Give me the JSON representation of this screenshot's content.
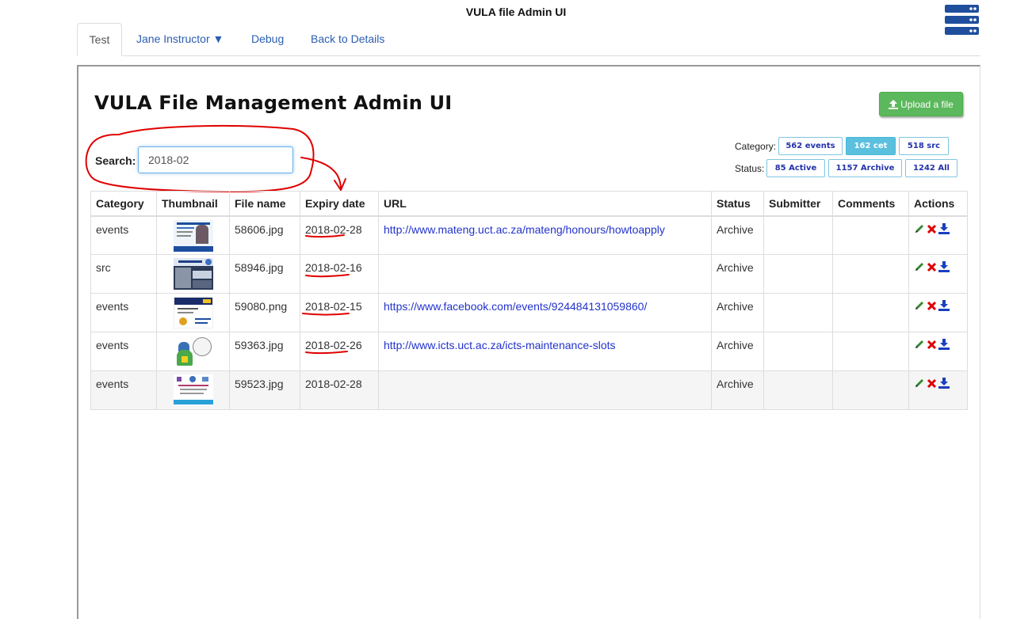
{
  "app": {
    "title": "VULA file Admin UI"
  },
  "tabs": [
    {
      "label": "Test",
      "active": true
    },
    {
      "label": "Jane Instructor ▼",
      "active": false
    },
    {
      "label": "Debug",
      "active": false
    },
    {
      "label": "Back to Details",
      "active": false
    }
  ],
  "page": {
    "title": "VULA File Management Admin UI"
  },
  "upload": {
    "label": "Upload a file"
  },
  "search": {
    "label": "Search:",
    "value": "2018-02"
  },
  "filters": {
    "category_label": "Category:",
    "category_buttons": [
      {
        "label": "562 events",
        "active": false
      },
      {
        "label": "162 cet",
        "active": true
      },
      {
        "label": "518 src",
        "active": false
      }
    ],
    "status_label": "Status:",
    "status_buttons": [
      {
        "label": "85 Active",
        "active": false
      },
      {
        "label": "1157 Archive",
        "active": false
      },
      {
        "label": "1242 All",
        "active": false
      }
    ]
  },
  "table": {
    "headers": [
      "Category",
      "Thumbnail",
      "File name",
      "Expiry date",
      "URL",
      "Status",
      "Submitter",
      "Comments",
      "Actions"
    ],
    "rows": [
      {
        "category": "events",
        "file_name": "58606.jpg",
        "expiry": "2018-02-28",
        "url": "http://www.mateng.uct.ac.za/mateng/honours/howtoapply",
        "status": "Archive",
        "submitter": "",
        "comments": ""
      },
      {
        "category": "src",
        "file_name": "58946.jpg",
        "expiry": "2018-02-16",
        "url": "",
        "status": "Archive",
        "submitter": "",
        "comments": ""
      },
      {
        "category": "events",
        "file_name": "59080.png",
        "expiry": "2018-02-15",
        "url": "https://www.facebook.com/events/924484131059860/",
        "status": "Archive",
        "submitter": "",
        "comments": ""
      },
      {
        "category": "events",
        "file_name": "59363.jpg",
        "expiry": "2018-02-26",
        "url": "http://www.icts.uct.ac.za/icts-maintenance-slots",
        "status": "Archive",
        "submitter": "",
        "comments": ""
      },
      {
        "category": "events",
        "file_name": "59523.jpg",
        "expiry": "2018-02-28",
        "url": "",
        "status": "Archive",
        "submitter": "",
        "comments": ""
      }
    ]
  },
  "icons": {
    "edit": "pencil-icon",
    "delete": "x-icon",
    "download": "download-icon",
    "upload": "upload-icon",
    "server": "server-icon"
  },
  "colors": {
    "upload_button": "#5cb85c",
    "active_filter": "#5bc0de",
    "link": "#2233cc",
    "annotation": "#e00000"
  }
}
